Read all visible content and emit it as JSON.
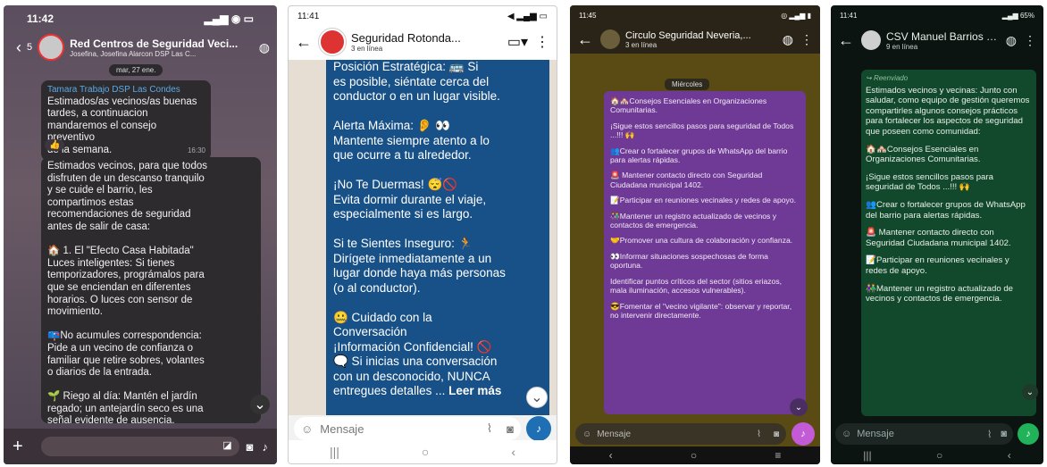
{
  "p1": {
    "time": "11:42",
    "status_icons": "▂▄▆ ◉ ▭",
    "back_count": "5",
    "title": "Red Centros de Seguridad Veci...",
    "subtitle": "Josefina, Josefina Alarcon DSP Las C...",
    "date_pill": "mar, 27 ene.",
    "msg1": {
      "sender": "Tamara Trabajo DSP Las Condes",
      "lines": [
        "Estimados/as vecinos/as buenas",
        "tardes, a continuacion",
        "mandaremos el consejo preventivo",
        "de la semana."
      ],
      "time": "16:30",
      "reaction": "👍"
    },
    "msg2": {
      "lines": [
        "Estimados vecinos, para que todos",
        "disfruten de un descanso tranquilo",
        "y se cuide el barrio, les",
        "compartimos estas",
        "recomendaciones de seguridad",
        "antes de salir de casa:",
        "",
        "🏠 1. El \"Efecto Casa Habitada\"",
        "Luces inteligentes: Si tienes",
        "temporizadores, prográmalos para",
        "que se enciendan en diferentes",
        "horarios. O luces con sensor de",
        "movimiento.",
        "",
        "📪No acumules correspondencia:",
        "Pide a un vecino de confianza o",
        "familiar que retire sobres, volantes",
        "o diarios de la entrada.",
        "",
        "🌱 Riego al día: Mantén el jardín",
        "regado; un antejardín seco es una",
        "señal evidente de ausencia."
      ]
    }
  },
  "p2": {
    "time": "11:41",
    "status_icons": "◀ ▂▄▆ ▭",
    "title": "Seguridad Rotonda...",
    "subtitle": "3 en línea",
    "lines": [
      "Posición Estratégica: 🚌 Si",
      "es posible, siéntate cerca del",
      "conductor o en un lugar visible.",
      "",
      "Alerta Máxima: 👂 👀",
      "Mantente siempre atento a lo",
      "que ocurre a tu alrededor.",
      "",
      "¡No Te Duermas! 😴🚫",
      "Evita dormir durante el viaje,",
      "especialmente si es largo.",
      "",
      "Si te Sientes Inseguro: 🏃",
      "Dirígete inmediatamente a un",
      "lugar donde haya más personas",
      "(o al conductor).",
      "",
      "🤐 Cuidado con la",
      "Conversación",
      "¡Información Confidencial! 🚫",
      "🗨️ Si inicias una conversación",
      "con un desconocido, NUNCA",
      "entregues detalles ..."
    ],
    "read_more": "Leer más",
    "input_placeholder": "Mensaje"
  },
  "p3": {
    "time": "11:45",
    "status_icons": "◎ ▂▄▆ ▮",
    "title": "Circulo Seguridad Neveria,...",
    "subtitle": "3 en línea",
    "day": "Miércoles",
    "paragraphs": [
      "🏠🏘️Consejos Esenciales en Organizaciones Comunitarias.",
      "¡Sigue estos sencillos pasos para seguridad de Todos ...!!! 🙌",
      "👥Crear o fortalecer grupos de WhatsApp del barrio para alertas rápidas.",
      "🚨 Mantener contacto directo con Seguridad Ciudadana municipal 1402.",
      "📝Participar en reuniones vecinales y redes de apoyo.",
      "👫Mantener un registro actualizado de vecinos y contactos de emergencia.",
      "🤝Promover una cultura de colaboración y confianza.",
      "👀Informar situaciones sospechosas de forma oportuna.",
      "Identificar puntos críticos del sector (sitios eriazos, mala iluminación, accesos vulnerables).",
      "😎Fomentar el \"vecino vigilante\": observar y reportar, no intervenir directamente."
    ],
    "input_placeholder": "Mensaje"
  },
  "p4": {
    "time": "11:41",
    "status_icons": "▂▄▆ 65%",
    "title": "CSV Manuel Barrios P...",
    "subtitle": "9 en línea",
    "forwarded": "Reenviado",
    "paragraphs": [
      "Estimados vecinos y vecinas: Junto con saludar, como equipo de gestión queremos compartirles algunos consejos prácticos para fortalecer los aspectos de seguridad que poseen como comunidad:",
      "🏠🏘️Consejos Esenciales en Organizaciones Comunitarias.",
      "¡Sigue estos sencillos pasos para seguridad de Todos ...!!! 🙌",
      "👥Crear o fortalecer grupos de WhatsApp del barrio para alertas rápidas.",
      "🚨 Mantener contacto directo con Seguridad Ciudadana municipal 1402.",
      "📝Participar en reuniones vecinales y redes de apoyo.",
      "👫Mantener un registro actualizado de vecinos y contactos de emergencia."
    ],
    "input_placeholder": "Mensaje"
  }
}
